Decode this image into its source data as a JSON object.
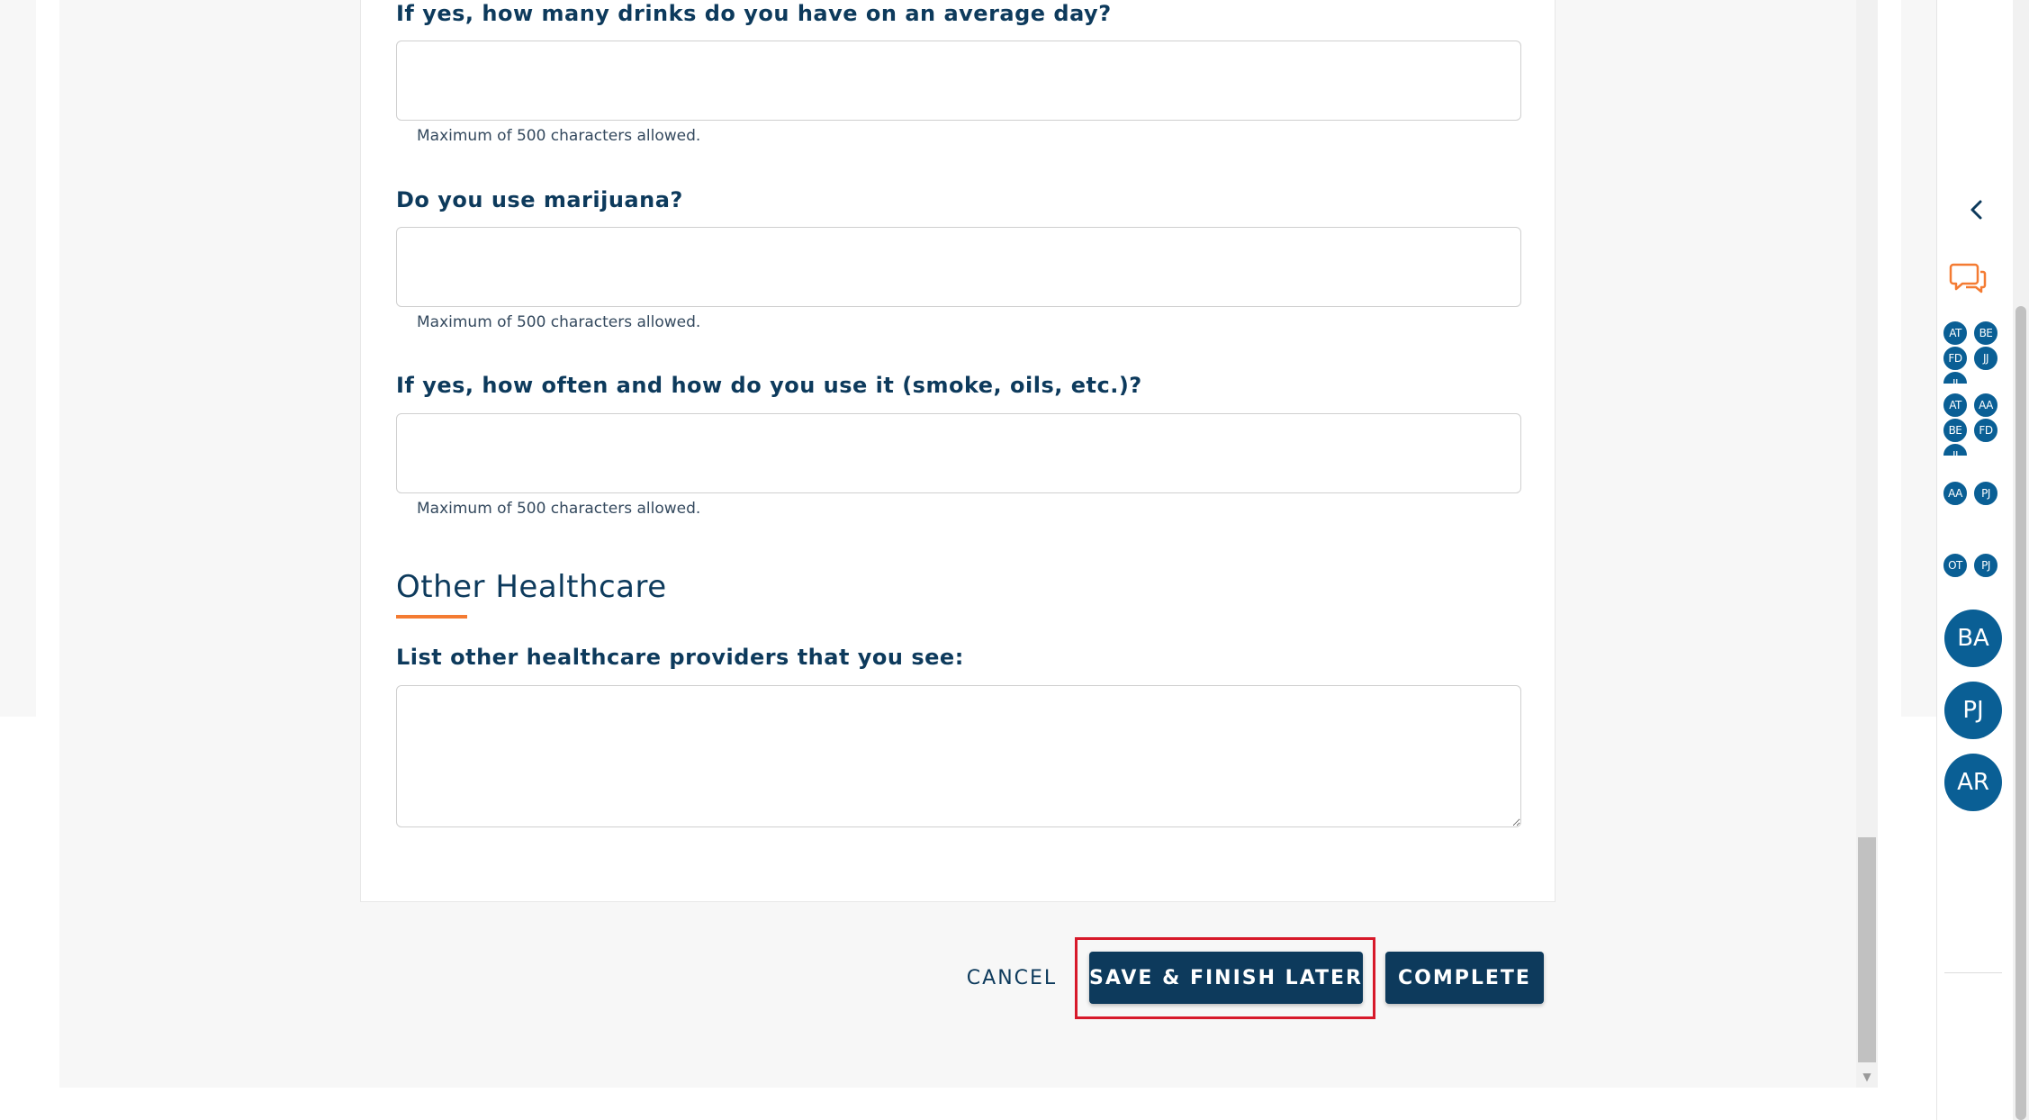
{
  "form": {
    "questions": [
      {
        "label": "If yes, how many drinks do you have on an average day?",
        "value": "",
        "helper": "Maximum of 500 characters allowed."
      },
      {
        "label": "Do you use marijuana?",
        "value": "",
        "helper": "Maximum of 500 characters allowed."
      },
      {
        "label": "If yes, how often and how do you use it (smoke, oils, etc.)?",
        "value": "",
        "helper": "Maximum of 500 characters allowed."
      }
    ],
    "section": {
      "title": "Other Healthcare",
      "question": {
        "label": "List other healthcare providers that you see:",
        "value": ""
      }
    }
  },
  "actions": {
    "cancel": "CANCEL",
    "save": "SAVE & FINISH LATER",
    "complete": "COMPLETE"
  },
  "sidebar": {
    "collapse_icon": "chevron-left-icon",
    "chat_icon": "chat-bubbles-icon",
    "groups": [
      [
        "AT",
        "BE",
        "FD",
        "JJ",
        "JJ"
      ],
      [
        "AT",
        "AA",
        "BE",
        "FD",
        "JJ"
      ],
      [
        "AA",
        "PJ"
      ],
      [
        "OT",
        "PJ"
      ]
    ],
    "participants": [
      "BA",
      "PJ",
      "AR"
    ]
  },
  "colors": {
    "primary": "#0d3a5c",
    "accent": "#f47b32",
    "avatar": "#0a5f95",
    "highlight": "#d7192a",
    "background": "#f7f7f7"
  }
}
